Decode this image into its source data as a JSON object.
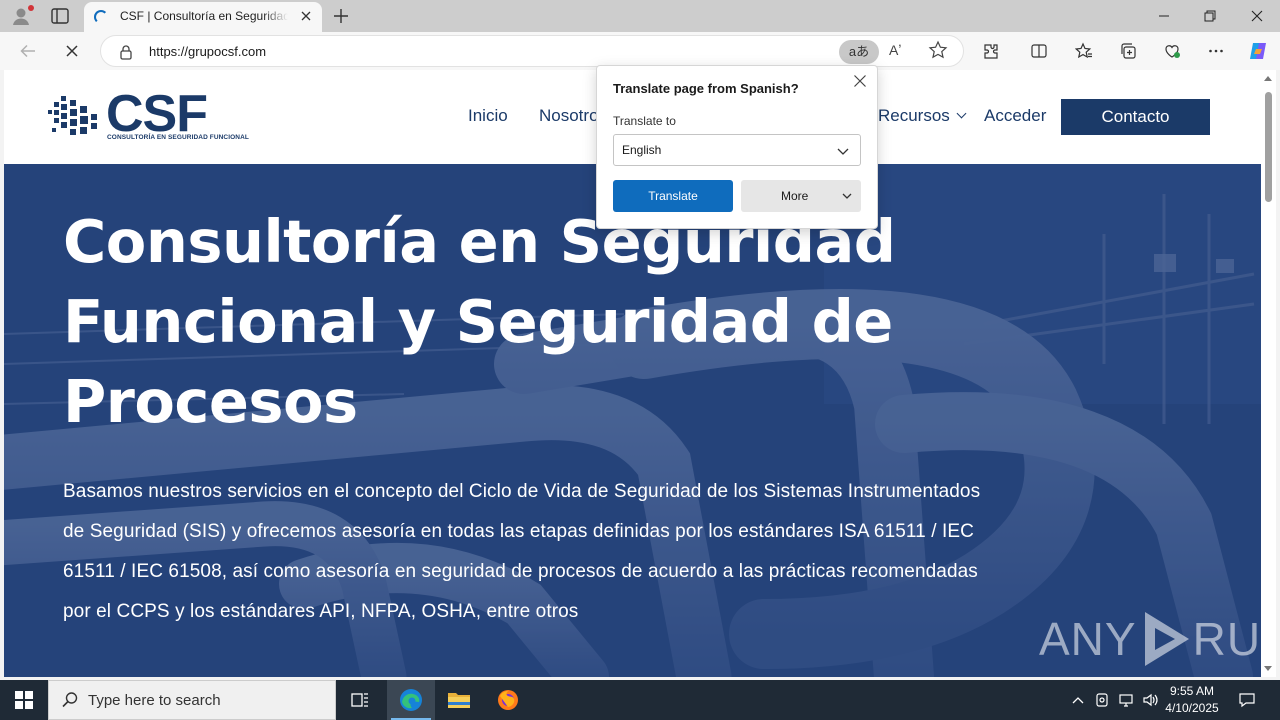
{
  "browser": {
    "tab_title": "CSF | Consultoría en Seguridad Funcional",
    "url": "https://grupocsf.com",
    "translate_icon_text": "aあ",
    "read_aloud_icon_text": "Aʼ"
  },
  "site": {
    "logo_text": "CSF",
    "logo_tagline": "CONSULTORÍA EN SEGURIDAD FUNCIONAL",
    "nav": {
      "inicio": "Inicio",
      "nosotros": "Nosotros",
      "recursos": "Recursos",
      "acceder": "Acceder",
      "contacto": "Contacto"
    },
    "hero": {
      "title": "Consultoría en Seguridad Funcional y Seguridad de Procesos",
      "body": "Basamos nuestros servicios en el concepto del Ciclo de Vida de Seguridad de los Sistemas Instrumentados de Seguridad (SIS) y ofrecemos asesoría en todas las etapas definidas por los estándares ISA 61511 / IEC 61511 / IEC 61508, así como asesoría en seguridad de procesos de acuerdo a las prácticas recomendadas por el CCPS y los estándares API, NFPA, OSHA, entre otros"
    }
  },
  "translate_popup": {
    "title": "Translate page from Spanish?",
    "label": "Translate to",
    "selected_language": "English",
    "translate_button": "Translate",
    "more_button": "More"
  },
  "watermark": {
    "left": "ANY",
    "right": "RUN"
  },
  "taskbar": {
    "search_placeholder": "Type here to search",
    "time": "9:55 AM",
    "date": "4/10/2025"
  },
  "colors": {
    "brand_navy": "#1b3a68",
    "edge_blue": "#0f6cbd",
    "taskbar": "#1f2a36"
  }
}
